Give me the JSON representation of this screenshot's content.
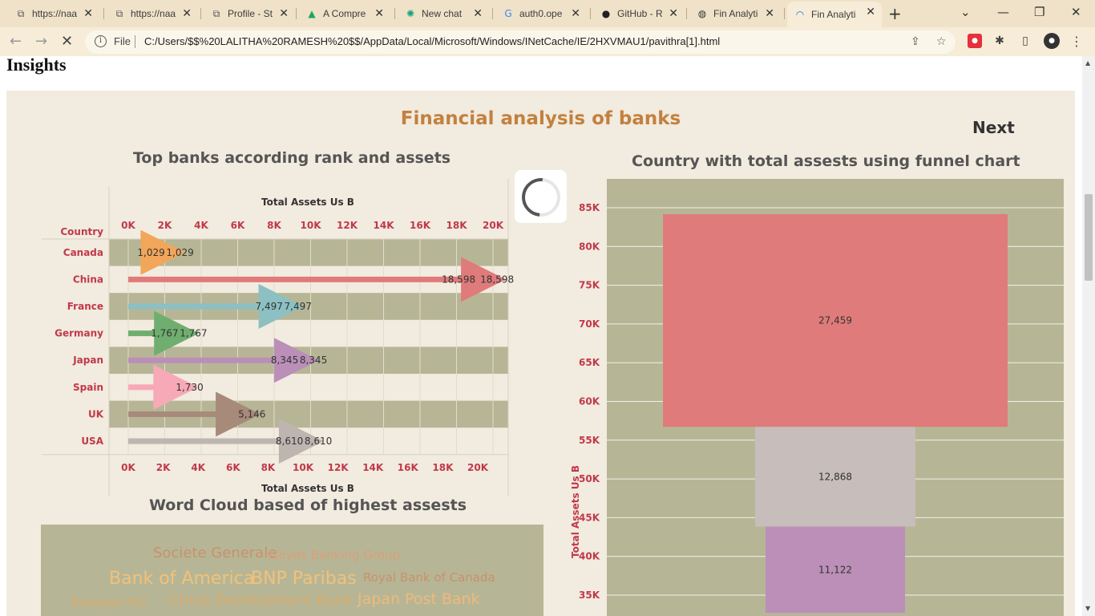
{
  "browser": {
    "tabs": [
      {
        "title": "https://naa",
        "icon": "page-icon"
      },
      {
        "title": "https://naa",
        "icon": "page-icon"
      },
      {
        "title": "Profile - St",
        "icon": "page-icon"
      },
      {
        "title": "A Compre",
        "icon": "google-drive-icon"
      },
      {
        "title": "New chat",
        "icon": "chatgpt-icon"
      },
      {
        "title": "auth0.ope",
        "icon": "google-icon"
      },
      {
        "title": "GitHub - R",
        "icon": "github-icon"
      },
      {
        "title": "Fin Analyti",
        "icon": "globe-icon"
      },
      {
        "title": "Fin Analyti",
        "icon": "loading-icon"
      }
    ],
    "file_label": "File",
    "url": "C:/Users/$$%20LALITHA%20RAMESH%20$$/AppData/Local/Microsoft/Windows/INetCache/IE/2HXVMAU1/pavithra[1].html"
  },
  "page": {
    "heading": "Insights",
    "dashboard_title": "Financial analysis of banks",
    "next_label": "Next",
    "sheet1_title": "Top banks according rank and assets",
    "sheet2_title": "Country with total assests using funnel chart",
    "sheet3_title": "Word Cloud based of highest assests"
  },
  "colors": {
    "accent_title": "#c2813f",
    "axis_label": "#c0394b",
    "chart_bg": "#b6b696",
    "dashboard_bg": "#f2ebdf"
  },
  "chart_data": [
    {
      "type": "bar",
      "title": "Top banks according rank and assets",
      "row_header": "Country",
      "xlabel": "Total Assets Us B",
      "xlim": [
        0,
        22000
      ],
      "ticks": [
        "0K",
        "2K",
        "4K",
        "6K",
        "8K",
        "10K",
        "12K",
        "14K",
        "16K",
        "18K",
        "20K"
      ],
      "categories": [
        "Canada",
        "China",
        "France",
        "Germany",
        "Japan",
        "Spain",
        "UK",
        "USA"
      ],
      "values": [
        1029,
        18598,
        7497,
        1767,
        8345,
        1730,
        5146,
        8610
      ],
      "labels": [
        [
          "1,029",
          "1,029"
        ],
        [
          "18,598",
          "18,598"
        ],
        [
          "7,497",
          "7,497"
        ],
        [
          "1,767",
          "1,767"
        ],
        [
          "8,345",
          "8,345"
        ],
        [
          "1,730"
        ],
        [
          "5,146"
        ],
        [
          "8,610",
          "8,610"
        ]
      ],
      "colors": [
        "#f2a65a",
        "#e07b7b",
        "#8cc0c2",
        "#6fae6f",
        "#bb8fb8",
        "#f7a9b8",
        "#a88a7a",
        "#bfb5b0"
      ]
    },
    {
      "type": "bar",
      "subtype": "funnel",
      "title": "Country with total assests using funnel chart",
      "ylabel": "Total Assets Us B",
      "yticks": [
        "85K",
        "80K",
        "75K",
        "70K",
        "65K",
        "60K",
        "55K",
        "50K",
        "45K",
        "40K",
        "35K"
      ],
      "values": [
        27459,
        12868,
        11122
      ],
      "labels": [
        "27,459",
        "12,868",
        "11,122"
      ],
      "colors": [
        "#e07b7b",
        "#c7bdba",
        "#bb8fb8"
      ]
    }
  ],
  "word_cloud": [
    {
      "text": "Societe Generale",
      "color": "#c9916a",
      "size": 18
    },
    {
      "text": "Lloyds Banking Group",
      "color": "#d9a07a",
      "size": 15
    },
    {
      "text": "Bank of America",
      "color": "#f2c17a",
      "size": 22
    },
    {
      "text": "BNP Paribas",
      "color": "#f2c17a",
      "size": 22
    },
    {
      "text": "Royal Bank of Canada",
      "color": "#c9916a",
      "size": 15
    },
    {
      "text": "Barclays PLC",
      "color": "#d9aa6a",
      "size": 15
    },
    {
      "text": "China Development Bank",
      "color": "#d9aa6a",
      "size": 18
    },
    {
      "text": "Japan Post Bank",
      "color": "#f0b97a",
      "size": 19
    }
  ]
}
